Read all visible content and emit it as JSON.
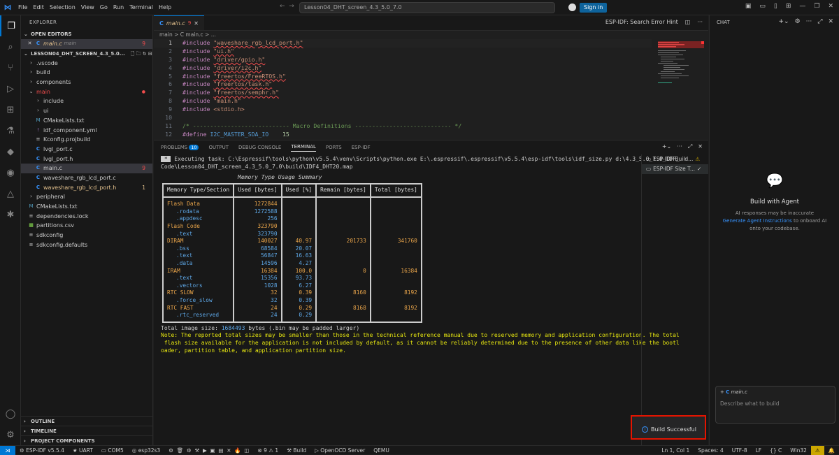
{
  "titlebar": {
    "menu": [
      "File",
      "Edit",
      "Selection",
      "View",
      "Go",
      "Run",
      "Terminal",
      "Help"
    ],
    "search_text": "Lesson04_DHT_screen_4.3_5.0_7.0",
    "signin_label": "Sign in"
  },
  "explorer": {
    "title": "EXPLORER",
    "open_editors_label": "OPEN EDITORS",
    "open_editor": {
      "name": "main.c",
      "folder": "main",
      "count": "9"
    },
    "project_label": "LESSON04_DHT_SCREEN_4.3_5.0...",
    "tree": [
      {
        "name": ".vscode",
        "kind": "folder"
      },
      {
        "name": "build",
        "kind": "folder"
      },
      {
        "name": "components",
        "kind": "folder"
      },
      {
        "name": "main",
        "kind": "folder-open"
      },
      {
        "name": "include",
        "kind": "folder"
      },
      {
        "name": "ui",
        "kind": "folder"
      },
      {
        "name": "CMakeLists.txt",
        "kind": "cmake"
      },
      {
        "name": "idf_component.yml",
        "kind": "yml"
      },
      {
        "name": "Kconfig.projbuild",
        "kind": "kconfig"
      },
      {
        "name": "lvgl_port.c",
        "kind": "c"
      },
      {
        "name": "lvgl_port.h",
        "kind": "c"
      },
      {
        "name": "main.c",
        "kind": "c",
        "badge": "9"
      },
      {
        "name": "waveshare_rgb_lcd_port.c",
        "kind": "c"
      },
      {
        "name": "waveshare_rgb_lcd_port.h",
        "kind": "c",
        "badge": "1"
      },
      {
        "name": "peripheral",
        "kind": "folder"
      },
      {
        "name": "CMakeLists.txt",
        "kind": "cmake"
      },
      {
        "name": "dependencies.lock",
        "kind": "file"
      },
      {
        "name": "partitions.csv",
        "kind": "csv"
      },
      {
        "name": "sdkconfig",
        "kind": "file"
      },
      {
        "name": "sdkconfig.defaults",
        "kind": "file"
      }
    ],
    "bottom_sections": [
      "OUTLINE",
      "TIMELINE",
      "PROJECT COMPONENTS"
    ]
  },
  "editor": {
    "tab_label": "main.c",
    "tab_badge": "9",
    "breadcrumb": "main  >  C  main.c  > ...",
    "hint_label": "ESP-IDF: Search Error Hint",
    "code_lines": [
      "1",
      "2",
      "3",
      "4",
      "5",
      "6",
      "7",
      "8",
      "9",
      "10",
      "11",
      "12"
    ],
    "includes": [
      "\"waveshare_rgb_lcd_port.h\"",
      "\"ui.h\"",
      "\"driver/gpio.h\"",
      "\"driver/i2c.h\"",
      "\"freertos/FreeRTOS.h\"",
      "\"freertos/task.h\"",
      "\"freertos/semphr.h\"",
      "\"main.h\"",
      "<stdio.h>"
    ],
    "comment_line": "/* ---------------------------- Macro Definitions ---------------------------- */",
    "define_name": "I2C_MASTER_SDA_IO",
    "define_value": "15"
  },
  "panel": {
    "tabs": [
      "PROBLEMS",
      "OUTPUT",
      "DEBUG CONSOLE",
      "TERMINAL",
      "PORTS",
      "ESP-IDF"
    ],
    "problems_count": "10",
    "terminal_list": [
      "ESP-IDF Build...",
      "ESP-IDF Size T..."
    ],
    "exec_line1": " Executing task: C:\\Espressif\\tools\\python\\v5.5.4\\venv\\Scripts\\python.exe E:\\.espressif\\.espressif\\v5.5.4\\esp-idf\\tools\\idf_size.py d:\\4.3_5.0_7.0_IDF_",
    "exec_line2": "Code\\Lesson04_DHT_screen_4.3_5.0_7.0\\build\\IDF4_DHT20.map",
    "summary_title": "Memory Type Usage Summary",
    "table_headers": [
      "Memory Type/Section",
      "Used [bytes]",
      "Used [%]",
      "Remain [bytes]",
      "Total [bytes]"
    ],
    "table_rows": [
      {
        "name": "Flash Data",
        "used": "1272844",
        "pct": "",
        "remain": "",
        "total": "",
        "level": 0
      },
      {
        "name": ".rodata",
        "used": "1272588",
        "pct": "",
        "remain": "",
        "total": "",
        "level": 1
      },
      {
        "name": ".appdesc",
        "used": "256",
        "pct": "",
        "remain": "",
        "total": "",
        "level": 1
      },
      {
        "name": "Flash Code",
        "used": "323790",
        "pct": "",
        "remain": "",
        "total": "",
        "level": 0
      },
      {
        "name": ".text",
        "used": "323790",
        "pct": "",
        "remain": "",
        "total": "",
        "level": 1
      },
      {
        "name": "DIRAM",
        "used": "140027",
        "pct": "40.97",
        "remain": "201733",
        "total": "341760",
        "level": 0
      },
      {
        "name": ".bss",
        "used": "68584",
        "pct": "20.07",
        "remain": "",
        "total": "",
        "level": 1
      },
      {
        "name": ".text",
        "used": "56847",
        "pct": "16.63",
        "remain": "",
        "total": "",
        "level": 1
      },
      {
        "name": ".data",
        "used": "14596",
        "pct": "4.27",
        "remain": "",
        "total": "",
        "level": 1
      },
      {
        "name": "IRAM",
        "used": "16384",
        "pct": "100.0",
        "remain": "0",
        "total": "16384",
        "level": 0
      },
      {
        "name": ".text",
        "used": "15356",
        "pct": "93.73",
        "remain": "",
        "total": "",
        "level": 1
      },
      {
        "name": ".vectors",
        "used": "1028",
        "pct": "6.27",
        "remain": "",
        "total": "",
        "level": 1
      },
      {
        "name": "RTC SLOW",
        "used": "32",
        "pct": "0.39",
        "remain": "8160",
        "total": "8192",
        "level": 0
      },
      {
        "name": ".force_slow",
        "used": "32",
        "pct": "0.39",
        "remain": "",
        "total": "",
        "level": 1
      },
      {
        "name": "RTC FAST",
        "used": "24",
        "pct": "0.29",
        "remain": "8168",
        "total": "8192",
        "level": 0
      },
      {
        "name": ".rtc_reserved",
        "used": "24",
        "pct": "0.29",
        "remain": "",
        "total": "",
        "level": 1
      }
    ],
    "total_image_prefix": "Total image size: ",
    "total_image_value": "1684493",
    "total_image_suffix": " bytes (.bin may be padded larger)",
    "note_lines": [
      "Note: The reported total sizes may be smaller than those in the technical reference manual due to reserved memory and application configuration. The total",
      " flash size available for the application is not included by default, as it cannot be reliably determined due to the presence of other data like the bootl",
      "oader, partition table, and application partition size."
    ]
  },
  "chat": {
    "title": "CHAT",
    "agent_title": "Build with Agent",
    "agent_desc_1": "AI responses may be inaccurate",
    "agent_link": "Generate Agent Instructions",
    "agent_desc_2": " to onboard AI onto your codebase.",
    "attachment": "main.c",
    "input_placeholder": "Describe what to build"
  },
  "toast": {
    "message": "Build Successful"
  },
  "statusbar": {
    "items_left": [
      "ESP-IDF v5.5.4",
      "UART",
      "COM5",
      "esp32s3",
      "9",
      "1",
      "Build",
      "OpenOCD Server",
      "QEMU"
    ],
    "items_right": [
      "Ln 1, Col 1",
      "Spaces: 4",
      "UTF-8",
      "LF",
      "{} C",
      "Win32"
    ],
    "warn_count": "⚠"
  },
  "colors": {
    "accent": "#0078d4",
    "toast_border": "#e51400",
    "warning": "#cca700",
    "flash_label": "#e8a44a",
    "section_label": "#5ea8e8",
    "note": "#e5e510"
  }
}
